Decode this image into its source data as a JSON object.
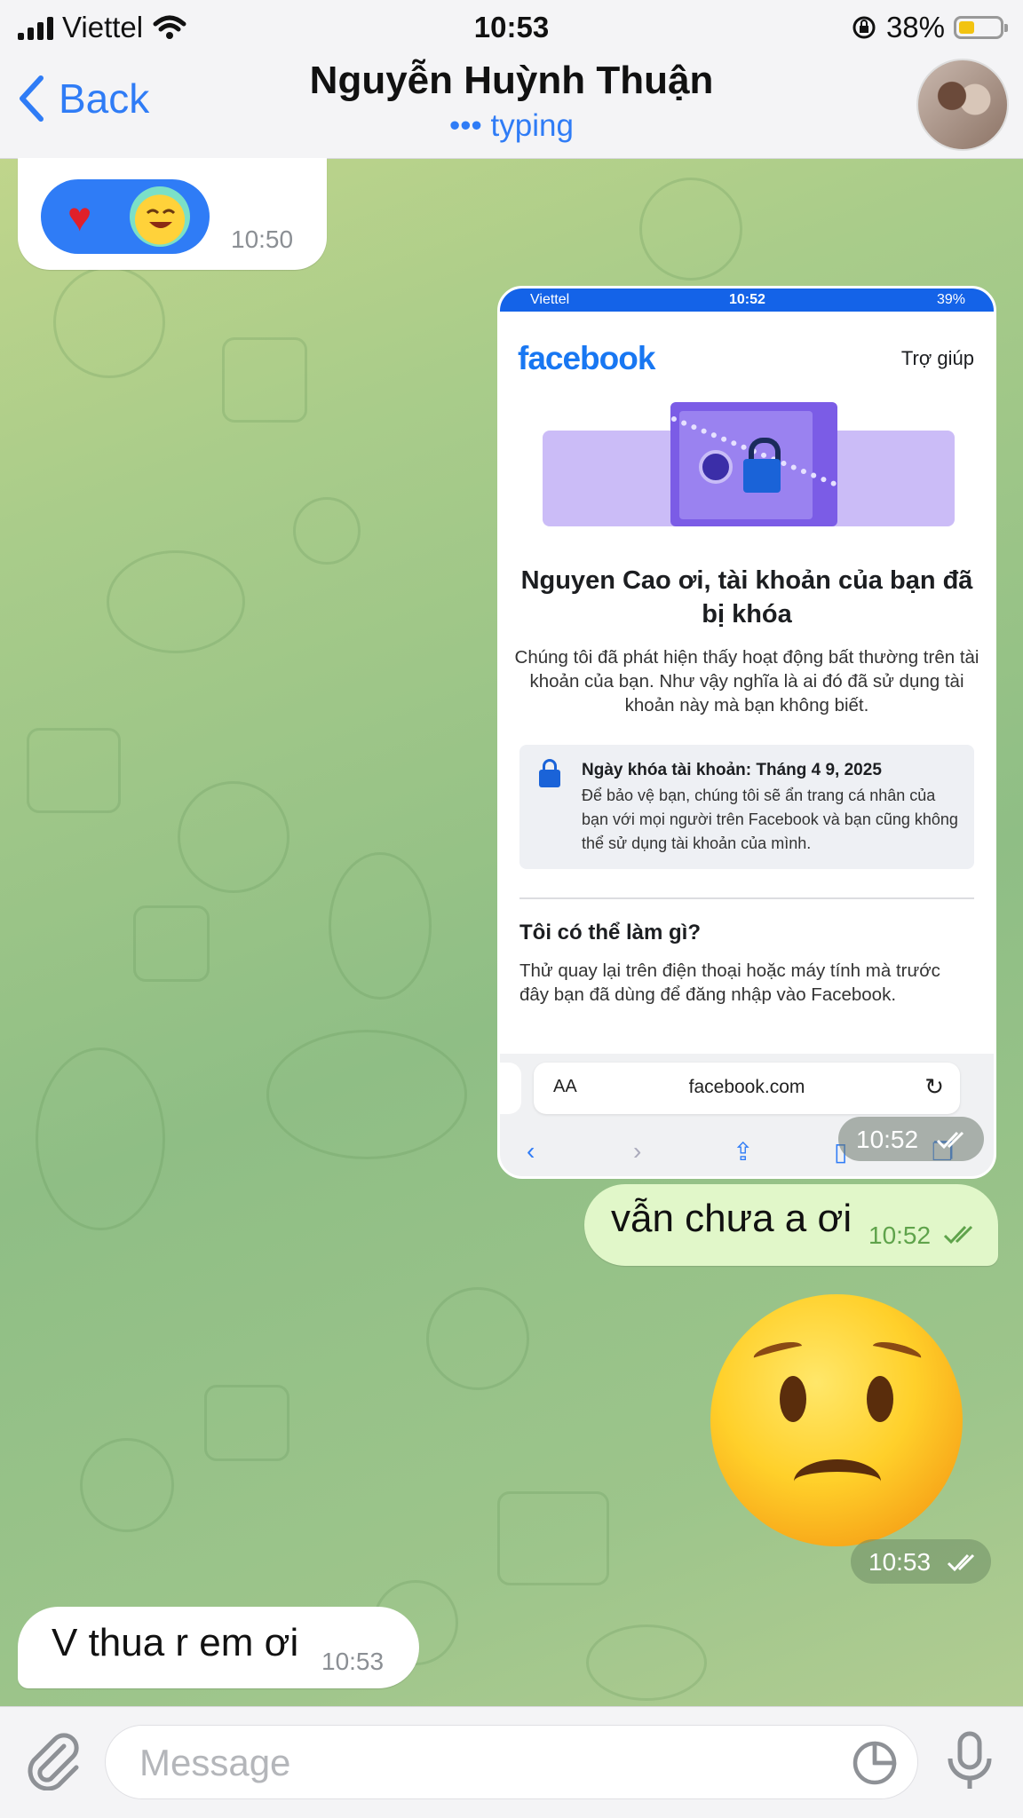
{
  "status_bar": {
    "carrier": "Viettel",
    "time": "10:53",
    "battery": "38%",
    "battery_level": 0.38,
    "battery_color": "#f2c311"
  },
  "header": {
    "back_label": "Back",
    "contact_name": "Nguyễn Huỳnh Thuận",
    "status": "••• typing",
    "accent_color": "#2f7cf6"
  },
  "messages": {
    "reaction_msg": {
      "time": "10:50",
      "icons": [
        "heart-emoji",
        "laughing-emoji"
      ]
    },
    "screenshot_msg": {
      "time": "10:52",
      "status_bar": {
        "carrier": "Viettel",
        "time": "10:52",
        "battery": "39%"
      },
      "brand": "facebook",
      "help_link": "Trợ giúp",
      "headline": "Nguyen Cao ơi, tài khoản của bạn đã bị khóa",
      "body": "Chúng tôi đã phát hiện thấy hoạt động bất thường trên tài khoản của bạn. Như vậy nghĩa là ai đó đã sử dụng tài khoản này mà bạn không biết.",
      "info_title": "Ngày khóa tài khoản: Tháng 4 9, 2025",
      "info_text": "Để bảo vệ bạn, chúng tôi sẽ ẩn trang cá nhân của bạn với mọi người trên Facebook và bạn cũng không thể sử dụng tài khoản của mình.",
      "section_title": "Tôi có thể làm gì?",
      "section_text": "Thử quay lại trên điện thoại hoặc máy tính mà trước đây bạn đã dùng để đăng nhập vào Facebook.",
      "text_size_label": "AA",
      "url": "facebook.com"
    },
    "text_msg_out": {
      "text": "vẫn chưa a ơi",
      "time": "10:52"
    },
    "emoji_msg": {
      "emoji": "worried-face",
      "time": "10:53"
    },
    "text_msg_in": {
      "text": "V thua r em ơi",
      "time": "10:53"
    }
  },
  "composer": {
    "placeholder": "Message"
  },
  "colors": {
    "outgoing_bubble": "#e1f7c9",
    "incoming_bubble": "#ffffff",
    "read_check": "#5fa34b"
  }
}
